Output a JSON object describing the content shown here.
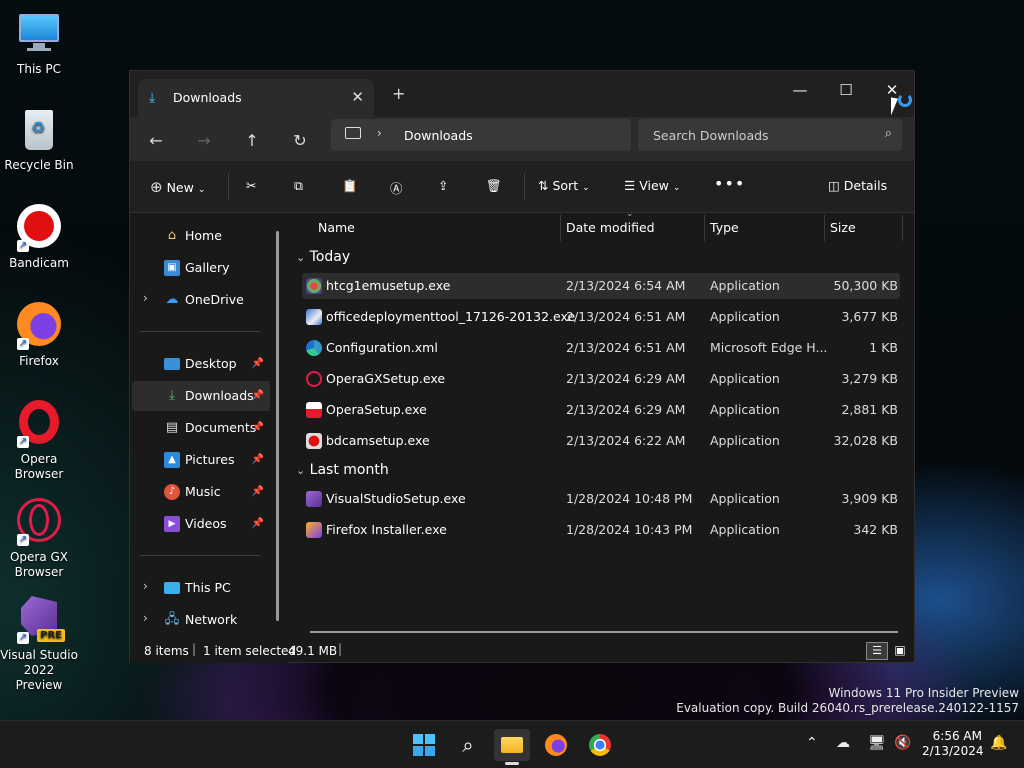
{
  "desktop": {
    "icons": [
      {
        "name": "this-pc",
        "label": "This PC"
      },
      {
        "name": "recycle-bin",
        "label": "Recycle Bin"
      },
      {
        "name": "bandicam",
        "label": "Bandicam"
      },
      {
        "name": "firefox",
        "label": "Firefox"
      },
      {
        "name": "opera",
        "label": "Opera Browser"
      },
      {
        "name": "opera-gx",
        "label": "Opera GX Browser"
      },
      {
        "name": "visual-studio",
        "label": "Visual Studio 2022 Preview",
        "badge": "PRE"
      }
    ]
  },
  "watermark": {
    "line1": "Windows 11 Pro Insider Preview",
    "line2": "Evaluation copy. Build 26040.rs_prerelease.240122-1157"
  },
  "window": {
    "tab_title": "Downloads",
    "breadcrumb": "Downloads",
    "search_placeholder": "Search Downloads",
    "toolbar": {
      "new": "New",
      "sort": "Sort",
      "view": "View",
      "details": "Details"
    },
    "nav": {
      "home": "Home",
      "gallery": "Gallery",
      "onedrive": "OneDrive",
      "desktop": "Desktop",
      "downloads": "Downloads",
      "documents": "Documents",
      "pictures": "Pictures",
      "music": "Music",
      "videos": "Videos",
      "thispc": "This PC",
      "network": "Network"
    },
    "columns": {
      "name": "Name",
      "date": "Date modified",
      "type": "Type",
      "size": "Size"
    },
    "groups": {
      "today": "Today",
      "last_month": "Last month"
    },
    "files": [
      {
        "name": "htcg1emusetup.exe",
        "date": "2/13/2024 6:54 AM",
        "type": "Application",
        "size": "50,300 KB"
      },
      {
        "name": "officedeploymenttool_17126-20132.exe",
        "date": "2/13/2024 6:51 AM",
        "type": "Application",
        "size": "3,677 KB"
      },
      {
        "name": "Configuration.xml",
        "date": "2/13/2024 6:51 AM",
        "type": "Microsoft Edge H...",
        "size": "1 KB"
      },
      {
        "name": "OperaGXSetup.exe",
        "date": "2/13/2024 6:29 AM",
        "type": "Application",
        "size": "3,279 KB"
      },
      {
        "name": "OperaSetup.exe",
        "date": "2/13/2024 6:29 AM",
        "type": "Application",
        "size": "2,881 KB"
      },
      {
        "name": "bdcamsetup.exe",
        "date": "2/13/2024 6:22 AM",
        "type": "Application",
        "size": "32,028 KB"
      },
      {
        "name": "VisualStudioSetup.exe",
        "date": "1/28/2024 10:48 PM",
        "type": "Application",
        "size": "3,909 KB"
      },
      {
        "name": "Firefox Installer.exe",
        "date": "1/28/2024 10:43 PM",
        "type": "Application",
        "size": "342 KB"
      }
    ],
    "status": {
      "count": "8 items",
      "selected": "1 item selected",
      "size": "49.1 MB"
    }
  },
  "taskbar": {
    "time": "6:56 AM",
    "date": "2/13/2024"
  }
}
